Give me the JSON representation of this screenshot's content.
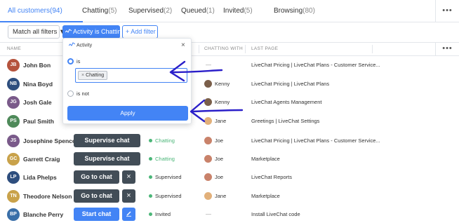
{
  "tabs": [
    {
      "label": "All customers",
      "count": "(94)"
    },
    {
      "label": "Chatting",
      "count": "(5)"
    },
    {
      "label": "Supervised",
      "count": "(2)"
    },
    {
      "label": "Queued",
      "count": "(1)"
    },
    {
      "label": "Invited",
      "count": "(5)"
    },
    {
      "label": "Browsing",
      "count": "(80)"
    }
  ],
  "more_glyph": "•••",
  "filters": {
    "match_label": "Match all filters ▼",
    "activity_chip": "Activity is Chatting",
    "add_filter": "+ Add filter"
  },
  "columns": {
    "name": "NAME",
    "chatting_with": "CHATTING WITH",
    "last_page": "LAST PAGE"
  },
  "popup": {
    "title": "Activity",
    "close": "×",
    "is_label": "is",
    "tag": "Chatting",
    "tag_remove": "×",
    "is_not_label": "is not",
    "apply": "Apply"
  },
  "customers": [
    {
      "initials": "JB",
      "name": "John Bon",
      "avatar_color": "#b5533d",
      "action": "",
      "status": "",
      "agent": "—",
      "last_page": "LiveChat Pricing | LiveChat Plans - Customer Service..."
    },
    {
      "initials": "NB",
      "name": "Nina Boyd",
      "avatar_color": "#2e4e7e",
      "action": "",
      "status": "",
      "agent": "Kenny",
      "last_page": "LiveChat Pricing | LiveChat Plans"
    },
    {
      "initials": "JG",
      "name": "Josh Gale",
      "avatar_color": "#7a5a8a",
      "action": "",
      "status": "",
      "agent": "Kenny",
      "last_page": "LiveChat Agents Management"
    },
    {
      "initials": "PS",
      "name": "Paul Smith",
      "avatar_color": "#4f8a5a",
      "action": "",
      "status": "",
      "agent": "Jane",
      "last_page": "Greetings | LiveChat Settings"
    },
    {
      "initials": "JS",
      "name": "Josephine Spencer",
      "avatar_color": "#7a5a8a",
      "action": "Supervise chat",
      "status": "Chatting",
      "agent": "Joe",
      "last_page": "LiveChat Pricing | LiveChat Plans - Customer Service..."
    },
    {
      "initials": "GC",
      "name": "Garrett Craig",
      "avatar_color": "#c9a24a",
      "action": "Supervise chat",
      "status": "Chatting",
      "agent": "Joe",
      "last_page": "Marketplace"
    },
    {
      "initials": "LP",
      "name": "Lida Phelps",
      "avatar_color": "#2e4e7e",
      "action": "Go to chat",
      "status": "Supervised",
      "agent": "Joe",
      "last_page": "LiveChat Reports"
    },
    {
      "initials": "TN",
      "name": "Theodore Nelson",
      "avatar_color": "#c9a24a",
      "action": "Go to chat",
      "status": "Supervised",
      "agent": "Jane",
      "last_page": "Marketplace"
    },
    {
      "initials": "BP",
      "name": "Blanche Perry",
      "avatar_color": "#3a6fa8",
      "action": "Start chat",
      "status": "Invited",
      "agent": "—",
      "last_page": "Install LiveChat code"
    }
  ],
  "colors": {
    "accent": "#4384f5",
    "chatting": "#4bb678",
    "supervised": "#4bb678",
    "invited": "#4bb678",
    "dark_button": "#424d57",
    "annotation": "#2b1fc9"
  },
  "icons": {
    "activity": "pulse-icon",
    "close": "close-icon",
    "remove_tag": "remove-tag-icon",
    "dismiss": "x-icon",
    "edit": "pencil-icon",
    "more": "more-horizontal-icon"
  }
}
